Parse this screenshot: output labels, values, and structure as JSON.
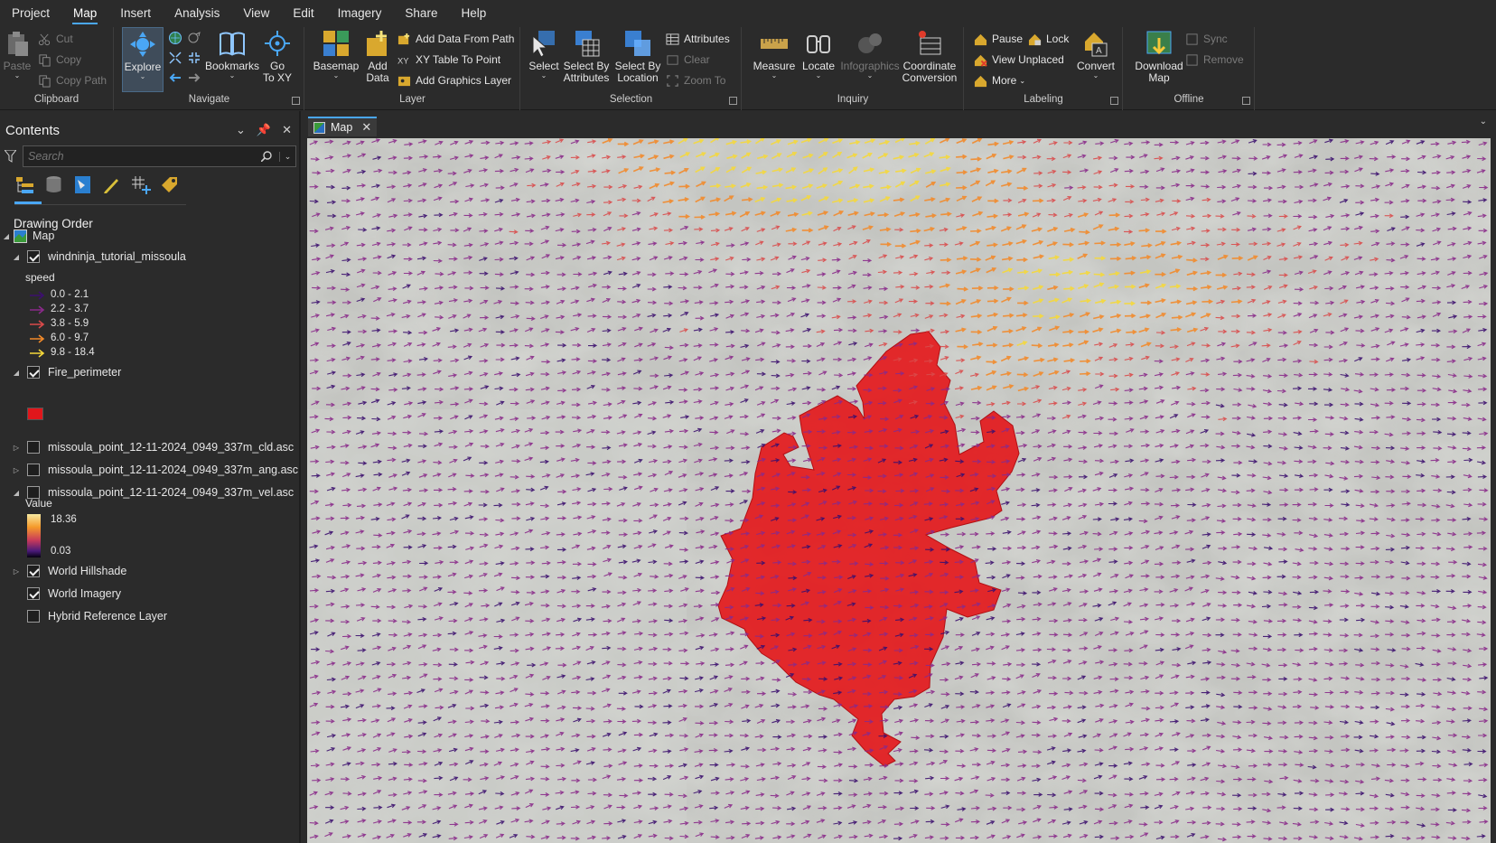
{
  "menu": {
    "tabs": [
      "Project",
      "Map",
      "Insert",
      "Analysis",
      "View",
      "Edit",
      "Imagery",
      "Share",
      "Help"
    ],
    "active": "Map"
  },
  "ribbon": {
    "clipboard": {
      "label": "Clipboard",
      "paste": "Paste",
      "cut": "Cut",
      "copy": "Copy",
      "copy_path": "Copy Path"
    },
    "navigate": {
      "label": "Navigate",
      "explore": "Explore",
      "bookmarks": "Bookmarks",
      "go_to_xy_1": "Go",
      "go_to_xy_2": "To XY"
    },
    "layer": {
      "label": "Layer",
      "basemap": "Basemap",
      "add_data_1": "Add",
      "add_data_2": "Data",
      "add_data_from_path": "Add Data From Path",
      "xy_table_to_point": "XY Table To Point",
      "add_graphics_layer": "Add Graphics Layer"
    },
    "selection": {
      "label": "Selection",
      "select": "Select",
      "select_by_attributes_1": "Select By",
      "select_by_attributes_2": "Attributes",
      "select_by_location_1": "Select By",
      "select_by_location_2": "Location",
      "attributes": "Attributes",
      "clear": "Clear",
      "zoom_to": "Zoom To"
    },
    "inquiry": {
      "label": "Inquiry",
      "measure": "Measure",
      "locate": "Locate",
      "infographics": "Infographics",
      "coordinate_conversion_1": "Coordinate",
      "coordinate_conversion_2": "Conversion"
    },
    "labeling": {
      "label": "Labeling",
      "pause": "Pause",
      "lock": "Lock",
      "view_unplaced": "View Unplaced",
      "more": "More",
      "convert": "Convert"
    },
    "offline": {
      "label": "Offline",
      "download_map_1": "Download",
      "download_map_2": "Map",
      "sync": "Sync",
      "remove": "Remove"
    }
  },
  "contents": {
    "title": "Contents",
    "search_placeholder": "Search",
    "drawing_order": "Drawing Order",
    "map_node": "Map",
    "layers": [
      {
        "name": "windninja_tutorial_missoula",
        "checked": true
      },
      {
        "name": "Fire_perimeter",
        "checked": true
      },
      {
        "name": "missoula_point_12-11-2024_0949_337m_cld.asc",
        "checked": false
      },
      {
        "name": "missoula_point_12-11-2024_0949_337m_ang.asc",
        "checked": false
      },
      {
        "name": "missoula_point_12-11-2024_0949_337m_vel.asc",
        "checked": false
      },
      {
        "name": "World Hillshade",
        "checked": true
      },
      {
        "name": "World Imagery",
        "checked": true
      },
      {
        "name": "Hybrid Reference Layer",
        "checked": false
      }
    ],
    "speed_legend": {
      "title": "speed",
      "classes": [
        "0.0 - 2.1",
        "2.2 - 3.7",
        "3.8 - 5.9",
        "6.0 - 9.7",
        "9.8 - 18.4"
      ],
      "colors": [
        "#3c0f6e",
        "#8a2a8a",
        "#d94a4a",
        "#f28a2a",
        "#f5d83a"
      ]
    },
    "fire_color": "#e0161b",
    "value_legend": {
      "title": "Value",
      "max": "18.36",
      "min": "0.03"
    }
  },
  "map_tab": {
    "label": "Map"
  },
  "colors": {
    "accent": "#4aa7f5",
    "fire": "#e31b1e",
    "panel": "#2b2b2b"
  }
}
